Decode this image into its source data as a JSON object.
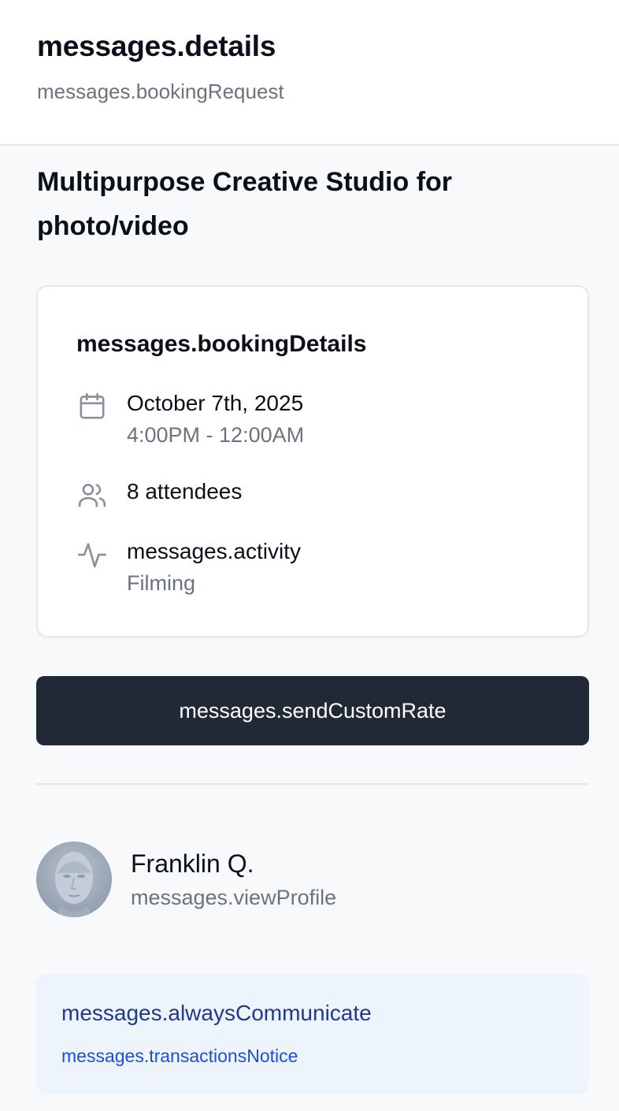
{
  "header": {
    "title": "messages.details",
    "subtitle": "messages.bookingRequest"
  },
  "listing": {
    "title": "Multipurpose Creative Studio for photo/video"
  },
  "booking_card": {
    "title": "messages.bookingDetails",
    "date": {
      "icon": "calendar-icon",
      "date_text": "October 7th, 2025",
      "time_range": "4:00PM - 12:00AM"
    },
    "attendees": {
      "icon": "users-icon",
      "text": "8 attendees"
    },
    "activity": {
      "icon": "activity-icon",
      "label": "messages.activity",
      "value": "Filming"
    }
  },
  "actions": {
    "send_custom_rate_label": "messages.sendCustomRate"
  },
  "user": {
    "name": "Franklin Q.",
    "view_profile_label": "messages.viewProfile"
  },
  "notice": {
    "title": "messages.alwaysCommunicate",
    "body": "messages.transactionsNotice"
  },
  "colors": {
    "page_background": "#f8f9fb",
    "button_background": "#222936",
    "notice_background": "#eef4fc",
    "notice_title": "#1e3a8a",
    "notice_body": "#1d4ed8",
    "muted_text": "#6b7280"
  }
}
